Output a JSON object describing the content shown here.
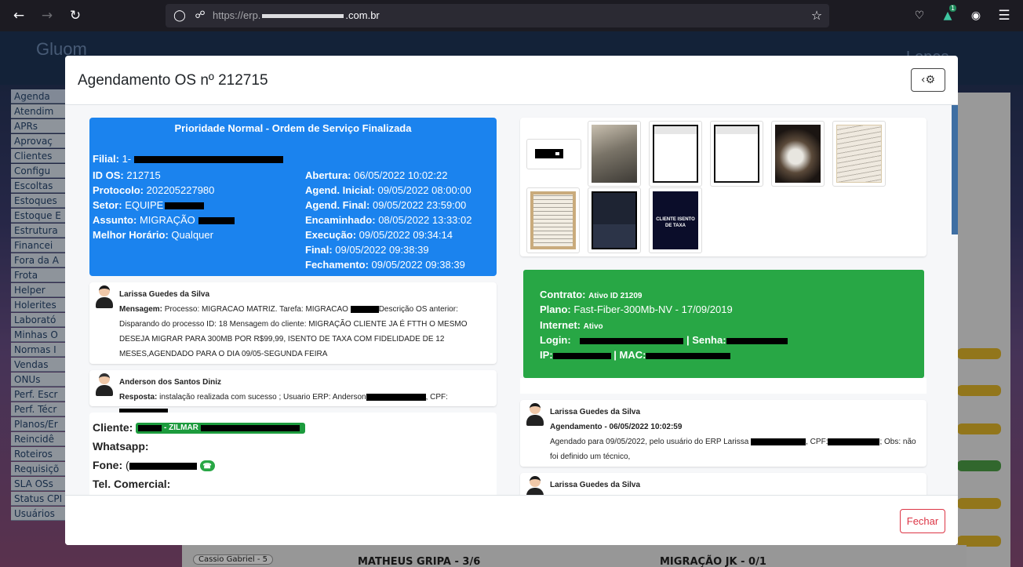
{
  "browser": {
    "url_prefix": "https://erp.",
    "url_suffix": ".com.br",
    "badge_count": "1",
    "icons": [
      "back-arrow",
      "forward-arrow",
      "reload",
      "shield",
      "lock",
      "star",
      "pocket",
      "extension",
      "account",
      "menu"
    ]
  },
  "app": {
    "logo": "Gluom",
    "user_name": "Lopes",
    "sidebar": [
      "Agenda",
      "Atendim",
      "APRs",
      "Aprovaç",
      "Clientes",
      "Configu",
      "Escoltas",
      "Estoques",
      "Estoque E",
      "Estrutura",
      "Financei",
      "Fora da A",
      "Frota",
      "Helper",
      "Holerites",
      "Laborató",
      "Minhas O",
      "Normas I",
      "Vendas",
      "ONUs",
      "Perf. Escr",
      "Perf. Técr",
      "Planos/Er",
      "Reincidê",
      "Roteiros",
      "Requisiçõ",
      "SLA OSs",
      "Status CPI",
      "Usuários"
    ],
    "bottom": {
      "tech": "Cassio Gabriel - 5",
      "col1": "MATHEUS GRIPA - 3/6",
      "col2": "MIGRAÇÃO JK - 0/1"
    }
  },
  "modal": {
    "title": "Agendamento OS nº 212715",
    "close_label": "Fechar",
    "os": {
      "status": "Prioridade Normal - Ordem de Serviço Finalizada",
      "filial_label": "Filial:",
      "filial_value": "1-",
      "id_label": "ID OS:",
      "id_value": "212715",
      "protocolo_label": "Protocolo:",
      "protocolo_value": "202205227980",
      "setor_label": "Setor:",
      "setor_value": "EQUIPE",
      "assunto_label": "Assunto:",
      "assunto_value": "MIGRAÇÃO",
      "horario_label": "Melhor Horário:",
      "horario_value": "Qualquer",
      "abertura_label": "Abertura:",
      "abertura_value": "06/05/2022 10:02:22",
      "ag_inicial_label": "Agend. Inicial:",
      "ag_inicial_value": "09/05/2022 08:00:00",
      "ag_final_label": "Agend. Final:",
      "ag_final_value": "09/05/2022 23:59:00",
      "encaminhado_label": "Encaminhado:",
      "encaminhado_value": "08/05/2022 13:33:02",
      "execucao_label": "Execução:",
      "execucao_value": "09/05/2022 09:34:14",
      "final_label": "Final:",
      "final_value": "09/05/2022 09:38:39",
      "fechamento_label": "Fechamento:",
      "fechamento_value": "09/05/2022 09:38:39"
    },
    "note1": {
      "author": "Larissa Guedes da Silva",
      "label": "Mensagem:",
      "text_a": "Processo: MIGRACAO MATRIZ. Tarefa: MIGRACAO",
      "text_b": "Descrição OS anterior: Disparando do processo ID: 18 Mensagem do cliente: MIGRAÇÃO CLIENTE JA É FTTH O MESMO DESEJA MIGRAR PARA 300MB POR R$99,99, ISENTO DE TAXA COM FIDELIDADE DE 12 MESES,AGENDADO PARA O DIA 09/05-SEGUNDA FEIRA"
    },
    "note2": {
      "author": "Anderson dos Santos Diniz",
      "label": "Resposta:",
      "text_a": "instalação realizada com sucesso ; Usuario ERP: Anderson",
      "text_b": ", CPF:"
    },
    "client": {
      "cliente_label": "Cliente:",
      "cliente_badge": "- ZILMAR",
      "whatsapp_label": "Whatsapp:",
      "fone_label": "Fone:",
      "fone_value": "(",
      "tel_label": "Tel. Comercial:"
    },
    "gallery": {
      "last_thumb_text": "CLIENTE ISENTO DE TAXA"
    },
    "contract": {
      "contrato_label": "Contrato:",
      "contrato_value": "Ativo ID 21209",
      "plano_label": "Plano:",
      "plano_value": "Fast-Fiber-300Mb-NV - 17/09/2019",
      "internet_label": "Internet:",
      "internet_value": "Ativo",
      "login_label": "Login:",
      "senha_label": "| Senha:",
      "ip_label": "IP:",
      "mac_label": "| MAC:"
    },
    "history1": {
      "author": "Larissa Guedes da Silva",
      "title": "Agendamento - 06/05/2022 10:02:59",
      "text_a": "Agendado para 09/05/2022, pelo usuário do ERP Larissa",
      "text_b": ", CPF:",
      "text_c": "; Obs: não foi definido um técnico,"
    },
    "history2": {
      "author": "Larissa Guedes da Silva"
    }
  }
}
